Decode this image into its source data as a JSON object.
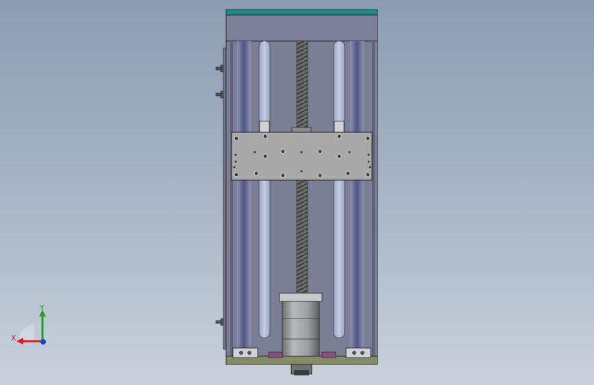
{
  "viewport": {
    "background_top": "#8c9db2",
    "background_bottom": "#c9d1dc"
  },
  "colors": {
    "top_accent": "#1f8a86",
    "frame": "#7a7f96",
    "rail": "#5d6389",
    "plate": "#a9a9a9",
    "motor": "#8e8f92"
  },
  "triad": {
    "x_label": "X",
    "y_label": "Y",
    "x_color": "#d81b1b",
    "y_color": "#1ea11e",
    "z_color": "#1b3fd8"
  }
}
